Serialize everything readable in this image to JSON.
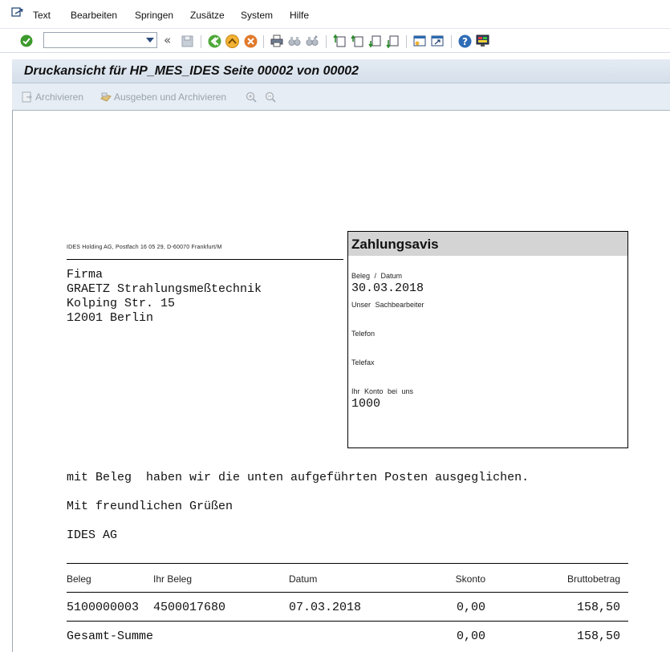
{
  "menu": {
    "items": [
      {
        "label": "Text"
      },
      {
        "label": "Bearbeiten"
      },
      {
        "label": "Springen"
      },
      {
        "label": "Zusätze"
      },
      {
        "label": "System"
      },
      {
        "label": "Hilfe"
      }
    ]
  },
  "toolbar": {
    "command_field_value": "",
    "icons": [
      "enter-icon",
      "save-icon",
      "back-icon",
      "exit-icon",
      "cancel-icon",
      "print-icon",
      "find-icon",
      "find-next-icon",
      "first-page-icon",
      "previous-page-icon",
      "next-page-icon",
      "last-page-icon",
      "new-session-icon",
      "shortcut-icon",
      "help-icon",
      "layout-icon"
    ]
  },
  "title": {
    "text": "Druckansicht für HP_MES_IDES Seite 00002 von 00002"
  },
  "app_toolbar": {
    "archive_label": "Archivieren",
    "output_archive_label": "Ausgeben und Archivieren"
  },
  "document": {
    "sender_line": "IDES Holding AG, Postfach 16 05 29, D-60070 Frankfurt/M",
    "address": {
      "line1": "Firma",
      "line2": "GRAETZ Strahlungsmeßtechnik",
      "line3": "Kolping Str. 15",
      "line4": "12001 Berlin"
    },
    "avis": {
      "title": "Zahlungsavis",
      "beleg_datum_label": "Beleg / Datum",
      "beleg_datum_value": "30.03.2018",
      "sachbearbeiter_label": "Unser Sachbearbeiter",
      "telefon_label": "Telefon",
      "telefax_label": "Telefax",
      "konto_label": "Ihr Konto bei uns",
      "konto_value": "1000"
    },
    "body_line1": "mit Beleg  haben wir die unten aufgeführten Posten ausgeglichen.",
    "body_line2": "Mit freundlichen Grüßen",
    "body_line3": "IDES AG",
    "table": {
      "headers": {
        "beleg": "Beleg",
        "ihr_beleg": "Ihr Beleg",
        "datum": "Datum",
        "skonto": "Skonto",
        "brutto": "Bruttobetrag"
      },
      "row": {
        "beleg": "5100000003",
        "ihr_beleg": "4500017680",
        "datum": "07.03.2018",
        "skonto": "0,00",
        "brutto": "158,50"
      },
      "total": {
        "label": "Gesamt-Summe",
        "skonto": "0,00",
        "brutto": "158,50"
      }
    }
  }
}
